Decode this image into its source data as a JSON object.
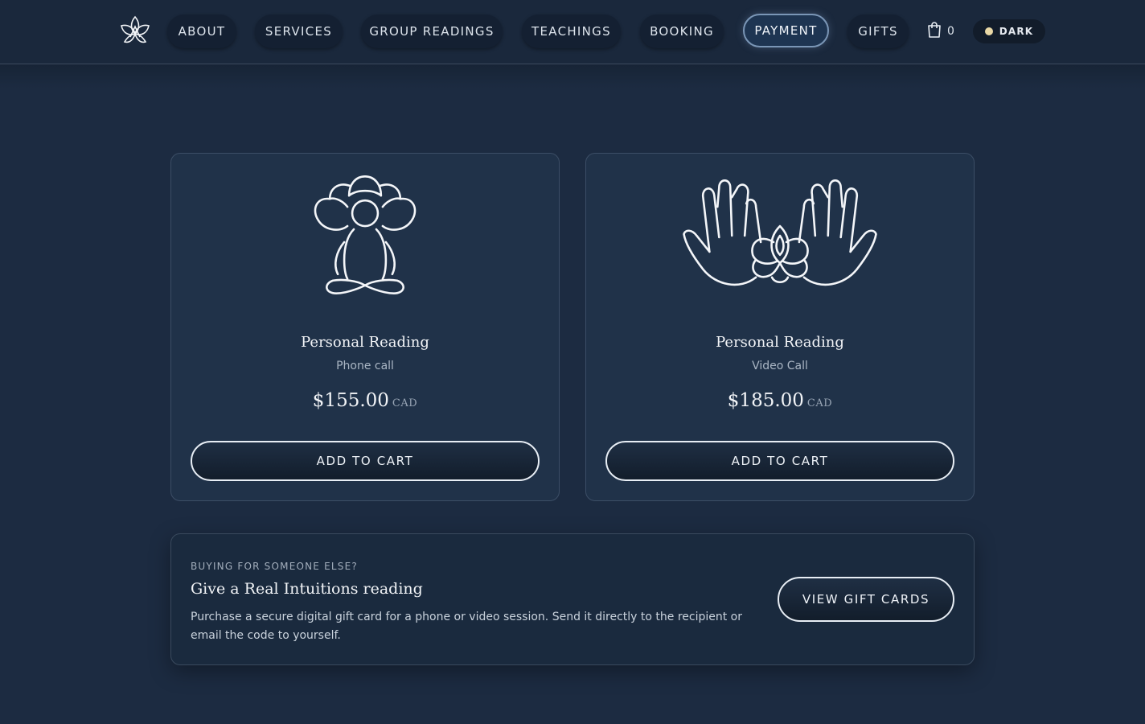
{
  "nav": {
    "items": [
      {
        "label": "ABOUT"
      },
      {
        "label": "SERVICES"
      },
      {
        "label": "GROUP READINGS"
      },
      {
        "label": "TEACHINGS"
      },
      {
        "label": "BOOKING"
      },
      {
        "label": "PAYMENT",
        "active": true
      },
      {
        "label": "GIFTS"
      }
    ],
    "cart_count": "0",
    "theme_label": "DARK"
  },
  "products": [
    {
      "icon": "meditating-figure-lotus-icon",
      "title": "Personal Reading",
      "subtitle": "Phone call",
      "price": "$155.00",
      "currency": "CAD",
      "button": "ADD TO CART"
    },
    {
      "icon": "open-hands-lotus-icon",
      "title": "Personal Reading",
      "subtitle": "Video Call",
      "price": "$185.00",
      "currency": "CAD",
      "button": "ADD TO CART"
    }
  ],
  "gift": {
    "eyebrow": "BUYING FOR SOMEONE ELSE?",
    "title": "Give a Real Intuitions reading",
    "text": "Purchase a secure digital gift card for a phone or video session. Send it directly to the recipient or email the code to yourself.",
    "button": "VIEW GIFT CARDS"
  },
  "colors": {
    "background": "#1c2b41",
    "header": "#1a283c",
    "card": "#203249",
    "accent_border": "#7a96b6",
    "toggle_dot": "#e9d8a6"
  }
}
